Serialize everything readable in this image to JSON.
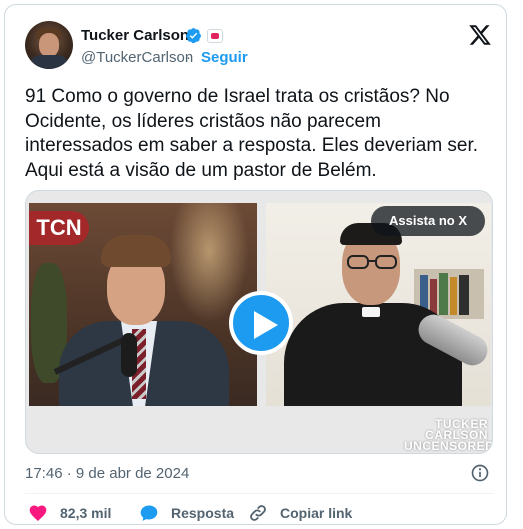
{
  "author": {
    "name": "Tucker Carlson",
    "handle": "@TuckerCarlson",
    "separator": "·",
    "follow_label": "Seguir"
  },
  "platform_icon": "x-logo-icon",
  "tweet_text": "91 Como o governo de Israel trata os cristãos? No Ocidente, os líderes cristãos não parecem interessados em saber a resposta. Eles deveriam ser. Aqui está a visão de um pastor de Belém.",
  "tweet_lines": [
    "91 Como o governo de Israel trata os cristãos? No",
    "Ocidente, os líderes cristãos não parecem",
    "interessados em saber a resposta. Eles deveriam ser.",
    "Aqui está a visão de um pastor de Belém."
  ],
  "media": {
    "left_logo": "TCN",
    "watch_label": "Assista no X",
    "play_icon": "play-icon",
    "watermark_lines": [
      "TUCKER",
      "CARLSON",
      "UNCENSORED"
    ]
  },
  "timestamp": "17:46 · 9 de abr de 2024",
  "actions": {
    "likes": "82,3 mil",
    "reply": "Resposta",
    "copy_link": "Copiar link"
  },
  "colors": {
    "accent": "#1d9bf0",
    "like": "#f91880",
    "text": "#0f1419",
    "muted": "#536471"
  }
}
